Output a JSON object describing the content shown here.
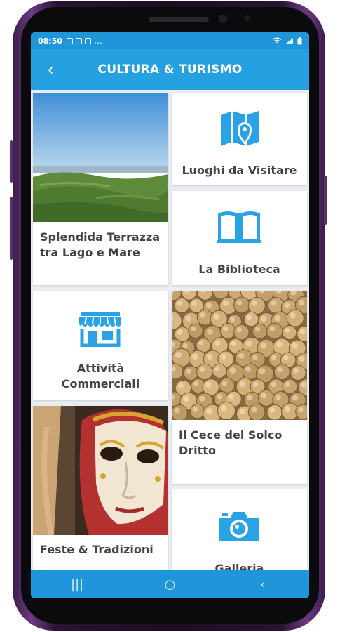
{
  "status_bar": {
    "time": "08:50",
    "more": "…",
    "battery_icon": "battery-icon",
    "wifi_icon": "wifi-icon"
  },
  "app_bar": {
    "title": "CULTURA & TURISMO",
    "back_icon": "‹"
  },
  "tiles": {
    "terrazza": {
      "label_line1": "Splendida Terrazza",
      "label_line2": "tra Lago e Mare"
    },
    "luoghi": {
      "label": "Luoghi da Visitare",
      "icon": "map-pin-icon"
    },
    "biblioteca": {
      "label": "La Biblioteca",
      "icon": "open-book-icon"
    },
    "attivita": {
      "label_line1": "Attività",
      "label_line2": "Commerciali",
      "icon": "shop-icon"
    },
    "cece": {
      "label_line1": "Il Cece del Solco",
      "label_line2": "Dritto"
    },
    "feste": {
      "label": "Feste & Tradizioni"
    },
    "galleria": {
      "label": "Galleria",
      "icon": "camera-icon"
    }
  },
  "nav_bar": {
    "recents": "|||",
    "home": "○",
    "back": "‹"
  },
  "colors": {
    "accent": "#25a0e0",
    "status_bar": "#1f96d9",
    "icon_blue": "#2aa3e6"
  }
}
